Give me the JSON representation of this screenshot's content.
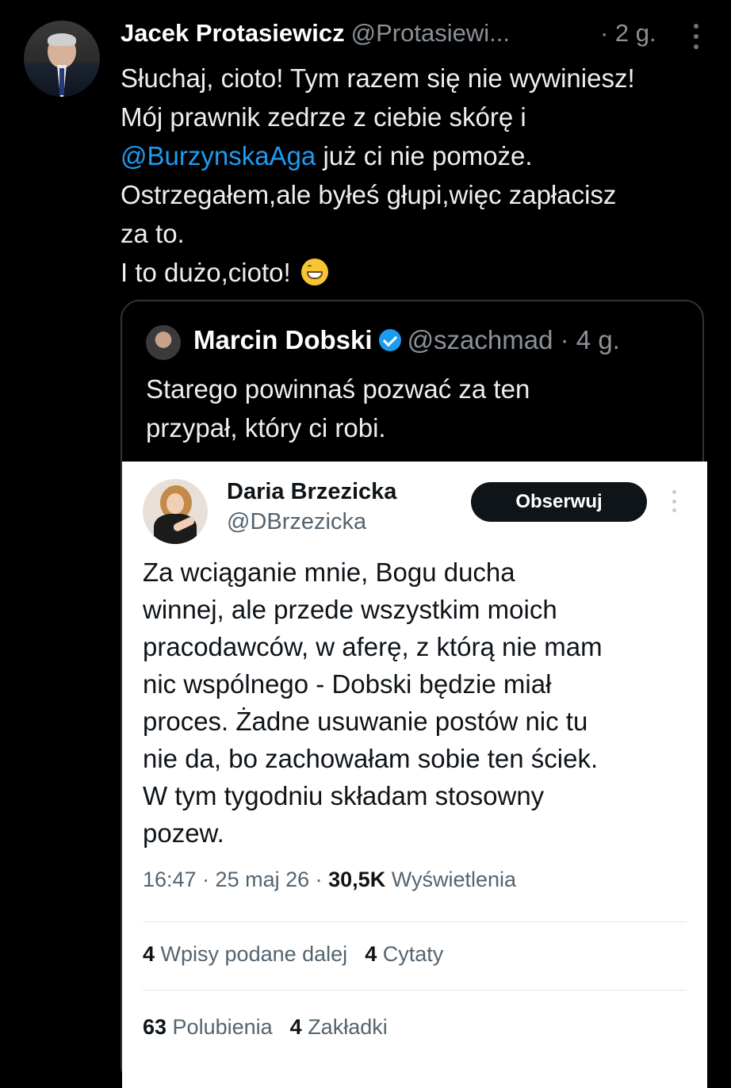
{
  "tweet": {
    "author_name": "Jacek Protasiewicz",
    "author_handle": "@Protasiewi...",
    "time": "· 2 g.",
    "avatar_icon": "profile-photo",
    "text_line1": "Słuchaj, cioto! Tym razem się nie wywiniesz!",
    "text_line2": "Mój prawnik zedrze z ciebie skórę i",
    "mention": "@BurzynskaAga",
    "text_line3_rest": " już ci nie pomoże.",
    "text_line4": "Ostrzegałem,ale byłeś głupi,więc zapłacisz",
    "text_line5": "za to.",
    "text_line6": "I to dużo,cioto! ",
    "emoji_icon": "grinning-face-icon",
    "mention_color": "#1d9bf0"
  },
  "quote": {
    "author_name": "Marcin Dobski",
    "author_handle": "@szachmad",
    "time": "· 4 g.",
    "verified_color": "#1d9bf0",
    "text_line1": "Starego powinnaś pozwać za ten",
    "text_line2": "przypał, który ci robi."
  },
  "screenshot": {
    "author_name": "Daria Brzezicka",
    "author_handle": "@DBrzezicka",
    "follow_label": "Obserwuj",
    "text_lines": [
      "Za wciąganie mnie, Bogu ducha",
      "winnej,  ale przede wszystkim moich",
      "pracodawców, w aferę, z którą nie mam",
      "nic wspólnego - Dobski będzie miał",
      "proces. Żadne usuwanie postów nic tu",
      "nie da, bo zachowałam sobie ten ściek.",
      "W tym tygodniu składam stosowny",
      "pozew."
    ],
    "meta_time": "16:47 · 25 maj 26 · ",
    "meta_views_count": "30,5K",
    "meta_views_label": " Wyświetlenia",
    "reposts_count": "4",
    "reposts_label": " Wpisy podane dalej",
    "quotes_count": "4",
    "quotes_label": " Cytaty",
    "likes_count": "63",
    "likes_label": " Polubienia",
    "bookmarks_count": "4",
    "bookmarks_label": " Zakładki"
  }
}
